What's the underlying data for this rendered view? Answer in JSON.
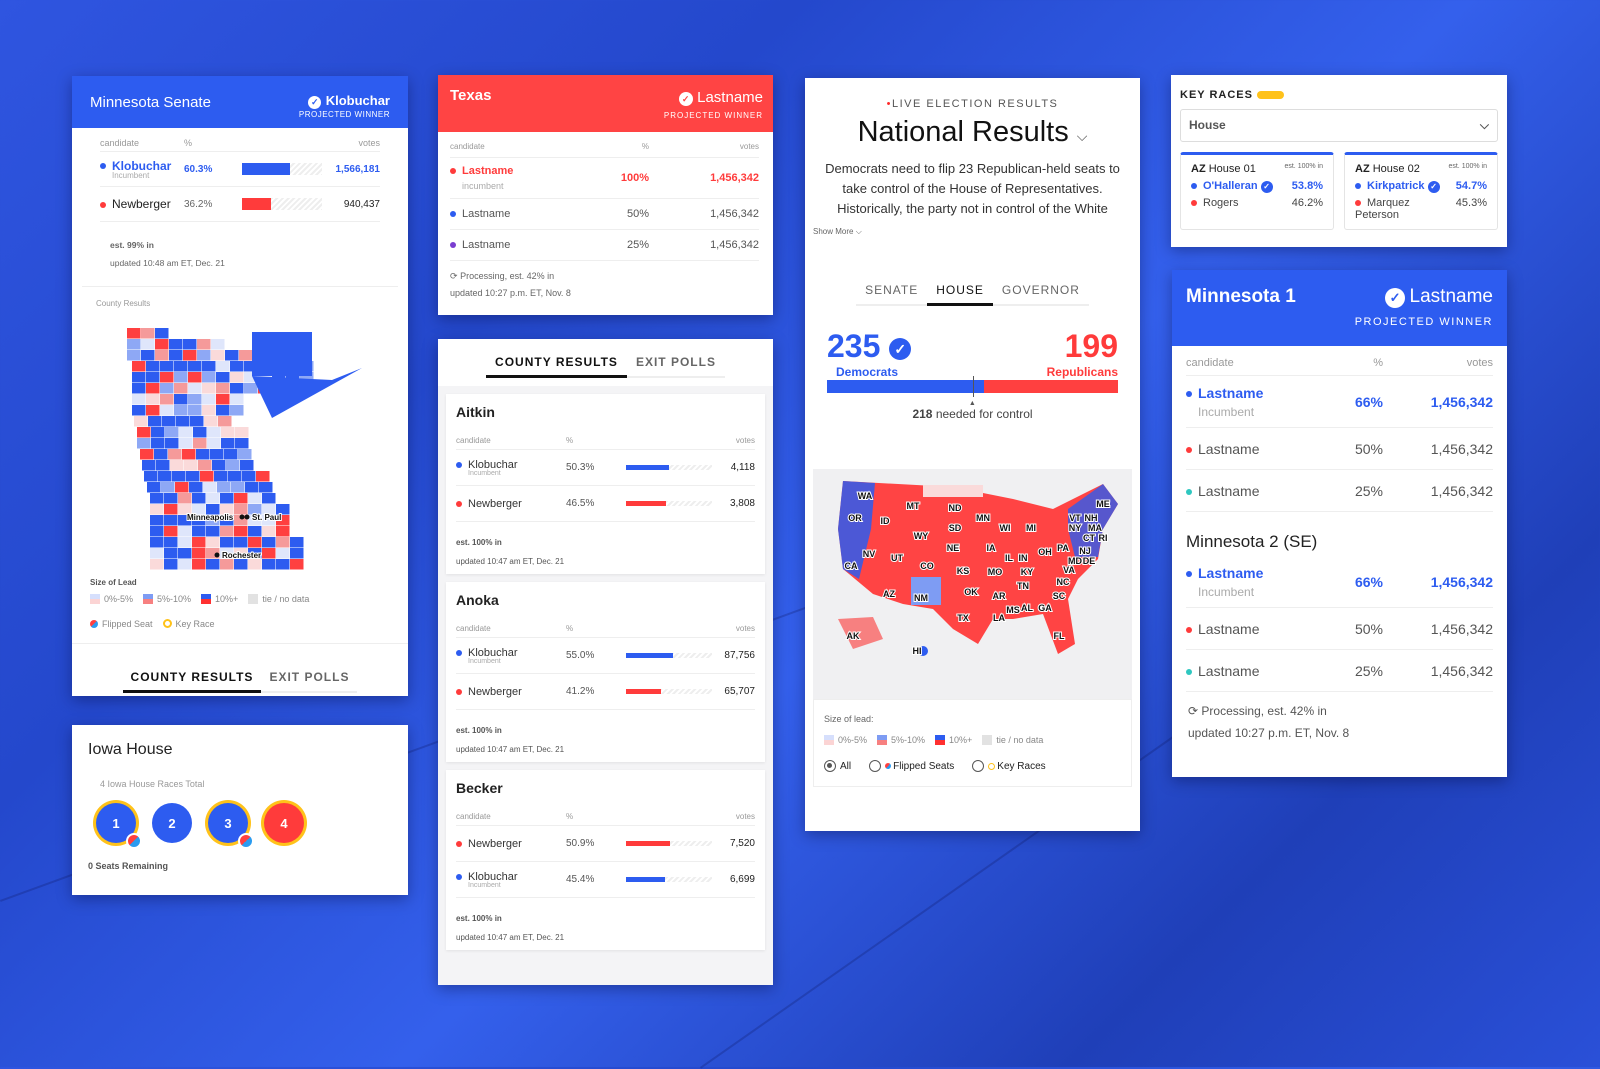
{
  "colors": {
    "dem": "#2d5cf0",
    "rep": "#ff4444",
    "key": "#ffc21a"
  },
  "mn_senate": {
    "title": "Minnesota Senate",
    "winner": "Klobuchar",
    "winner_label": "PROJECTED WINNER",
    "headers": [
      "candidate",
      "%",
      "votes"
    ],
    "rows": [
      {
        "name": "Klobuchar",
        "note": "Incumbent",
        "pct": "60.3%",
        "votes": "1,566,181",
        "party": "dem",
        "share": 60.3
      },
      {
        "name": "Newberger",
        "pct": "36.2%",
        "votes": "940,437",
        "party": "rep",
        "share": 36.2
      }
    ],
    "est": "est. 99% in",
    "updated": "updated 10:48 am ET, Dec. 21",
    "county_label": "County Results",
    "cities": [
      "Minneapolis",
      "St. Paul",
      "Rochester"
    ],
    "legend_title": "Size of Lead",
    "legend": [
      "0%-5%",
      "5%-10%",
      "10%+",
      "tie / no data"
    ],
    "flipped": "Flipped Seat",
    "key_race": "Key Race",
    "tabs": [
      "COUNTY RESULTS",
      "EXIT POLLS"
    ]
  },
  "iowa": {
    "title": "Iowa House",
    "total": "4 Iowa House Races Total",
    "races": [
      {
        "n": "1",
        "party": "dem",
        "key": true,
        "flipped": true
      },
      {
        "n": "2",
        "party": "dem",
        "key": false,
        "flipped": false
      },
      {
        "n": "3",
        "party": "dem",
        "key": true,
        "flipped": true
      },
      {
        "n": "4",
        "party": "rep",
        "key": true,
        "flipped": false
      }
    ],
    "remaining": "0 Seats Remaining"
  },
  "texas": {
    "title": "Texas",
    "winner": "Lastname",
    "winner_label": "PROJECTED WINNER",
    "headers": [
      "candidate",
      "%",
      "votes"
    ],
    "rows": [
      {
        "name": "Lastname",
        "note": "incumbent",
        "pct": "100%",
        "votes": "1,456,342",
        "party": "rep"
      },
      {
        "name": "Lastname",
        "pct": "50%",
        "votes": "1,456,342",
        "party": "dem"
      },
      {
        "name": "Lastname",
        "pct": "25%",
        "votes": "1,456,342",
        "party": "other"
      }
    ],
    "processing": "Processing, est. 42% in",
    "updated": "updated 10:27 p.m. ET, Nov. 8"
  },
  "county": {
    "tabs": [
      "COUNTY RESULTS",
      "EXIT POLLS"
    ],
    "headers": [
      "candidate",
      "%",
      "votes"
    ],
    "counties": [
      {
        "name": "Aitkin",
        "rows": [
          {
            "name": "Klobuchar",
            "note": "Incumbent",
            "pct": "50.3%",
            "votes": "4,118",
            "party": "dem",
            "share": 50.3
          },
          {
            "name": "Newberger",
            "pct": "46.5%",
            "votes": "3,808",
            "party": "rep",
            "share": 46.5
          }
        ],
        "est": "est. 100% in",
        "updated": "updated 10:47 am ET, Dec. 21"
      },
      {
        "name": "Anoka",
        "rows": [
          {
            "name": "Klobuchar",
            "note": "Incumbent",
            "pct": "55.0%",
            "votes": "87,756",
            "party": "dem",
            "share": 55.0
          },
          {
            "name": "Newberger",
            "pct": "41.2%",
            "votes": "65,707",
            "party": "rep",
            "share": 41.2
          }
        ],
        "est": "est. 100% in",
        "updated": "updated 10:47 am ET, Dec. 21"
      },
      {
        "name": "Becker",
        "rows": [
          {
            "name": "Newberger",
            "pct": "50.9%",
            "votes": "7,520",
            "party": "rep",
            "share": 50.9
          },
          {
            "name": "Klobuchar",
            "note": "Incumbent",
            "pct": "45.4%",
            "votes": "6,699",
            "party": "dem",
            "share": 45.4
          }
        ],
        "est": "est. 100% in",
        "updated": "updated 10:47 am ET, Dec. 21"
      }
    ]
  },
  "national": {
    "live": "LIVE ELECTION RESULTS",
    "title": "National Results",
    "desc": "Democrats need to flip 23 Republican-held seats to take control of the House of Representatives. Historically, the party not in control of the White",
    "show_more": "Show More",
    "tabs": [
      "SENATE",
      "HOUSE",
      "GOVERNOR"
    ],
    "active_tab": "HOUSE",
    "dem_seats": "235",
    "dem_label": "Democrats",
    "rep_seats": "199",
    "rep_label": "Republicans",
    "needed": "218",
    "needed_text": "needed for control",
    "dem_share": 0.54,
    "states": [
      "WA",
      "OR",
      "ID",
      "MT",
      "ND",
      "MN",
      "WI",
      "MI",
      "ME",
      "VT",
      "NH",
      "NY",
      "MA",
      "CT",
      "RI",
      "PA",
      "NJ",
      "DE",
      "MD",
      "CA",
      "NV",
      "UT",
      "WY",
      "SD",
      "NE",
      "IA",
      "IL",
      "IN",
      "OH",
      "CO",
      "KS",
      "MO",
      "KY",
      "VA",
      "AZ",
      "NM",
      "OK",
      "AR",
      "TN",
      "NC",
      "SC",
      "TX",
      "LA",
      "MS",
      "AL",
      "GA",
      "FL",
      "AK",
      "HI"
    ],
    "legend_title": "Size of lead:",
    "legend": [
      "0%-5%",
      "5%-10%",
      "10%+",
      "tie / no data"
    ],
    "filters": [
      "All",
      "Flipped Seats",
      "Key Races"
    ],
    "active_filter": "All"
  },
  "key_races": {
    "title": "KEY RACES",
    "select": "House",
    "races": [
      {
        "state": "AZ",
        "name": "House 01",
        "est": "est. 100% in",
        "c1": "O'Halleran",
        "p1": "53.8%",
        "c2": "Rogers",
        "p2": "46.2%"
      },
      {
        "state": "AZ",
        "name": "House 02",
        "est": "est. 100% in",
        "c1": "Kirkpatrick",
        "p1": "54.7%",
        "c2": "Marquez Peterson",
        "p2": "45.3%"
      }
    ]
  },
  "mn1": {
    "title": "Minnesota 1",
    "winner": "Lastname",
    "winner_label": "PROJECTED WINNER",
    "headers": [
      "candidate",
      "%",
      "votes"
    ],
    "rows": [
      {
        "name": "Lastname",
        "note": "Incumbent",
        "pct": "66%",
        "votes": "1,456,342",
        "party": "dem"
      },
      {
        "name": "Lastname",
        "pct": "50%",
        "votes": "1,456,342",
        "party": "rep"
      },
      {
        "name": "Lastname",
        "pct": "25%",
        "votes": "1,456,342",
        "party": "ind"
      }
    ],
    "sub_title": "Minnesota 2 (SE)",
    "rows2": [
      {
        "name": "Lastname",
        "note": "Incumbent",
        "pct": "66%",
        "votes": "1,456,342",
        "party": "dem"
      },
      {
        "name": "Lastname",
        "pct": "50%",
        "votes": "1,456,342",
        "party": "rep"
      },
      {
        "name": "Lastname",
        "pct": "25%",
        "votes": "1,456,342",
        "party": "ind"
      }
    ],
    "processing": "Processing, est. 42% in",
    "updated": "updated 10:27 p.m. ET, Nov. 8"
  }
}
